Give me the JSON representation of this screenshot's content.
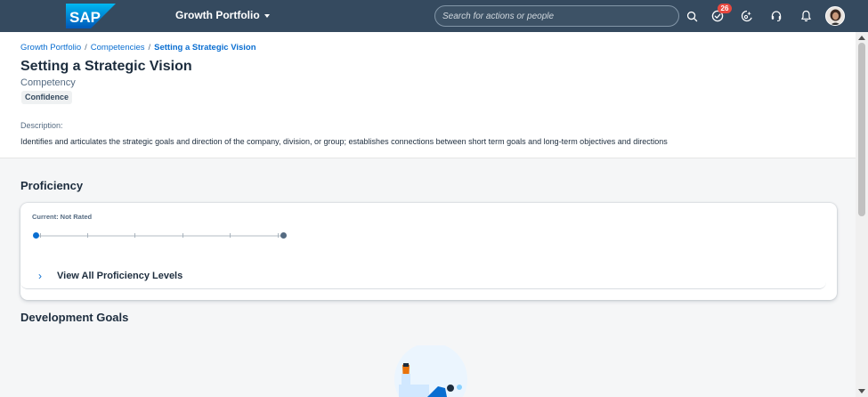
{
  "shell": {
    "logo_text": "SAP",
    "app_title": "Growth Portfolio",
    "search_placeholder": "Search for actions or people",
    "notification_count": "26",
    "colors": {
      "shell_bg": "#354a5f",
      "logo_blue": "#0a6ed1",
      "badge_red": "#e8483f"
    },
    "icons": [
      "search-icon",
      "tasks-icon",
      "ai-assistant-icon",
      "support-icon",
      "bell-icon",
      "avatar"
    ]
  },
  "breadcrumb": {
    "items": [
      "Growth Portfolio",
      "Competencies"
    ],
    "separator": "/",
    "current": "Setting a Strategic Vision"
  },
  "header": {
    "title": "Setting a Strategic Vision",
    "subtitle": "Competency",
    "tag": "Confidence",
    "description_label": "Description:",
    "description": "Identifies and articulates the strategic goals and direction of the company, division, or group; establishes connections between short term goals and long-term objectives and directions"
  },
  "proficiency": {
    "section_title": "Proficiency",
    "current_label": "Current: Not Rated",
    "expand_label": "View All Proficiency Levels"
  },
  "development_goals": {
    "section_title": "Development Goals"
  }
}
